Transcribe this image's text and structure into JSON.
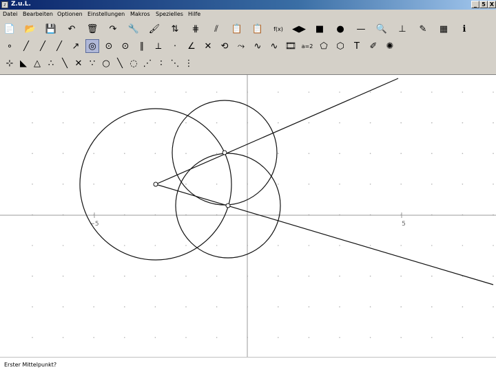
{
  "window": {
    "title": "Z.u.L."
  },
  "window_buttons": {
    "minimize": "_",
    "maximize": "5",
    "close": "X"
  },
  "menu": [
    "Datei",
    "Bearbeiten",
    "Optionen",
    "Einstellungen",
    "Makros",
    "Spezielles",
    "Hilfe"
  ],
  "toolbar": {
    "row1": [
      {
        "name": "new-icon",
        "glyph": "📄"
      },
      {
        "name": "open-icon",
        "glyph": "📂"
      },
      {
        "name": "save-icon",
        "glyph": "💾"
      },
      {
        "name": "undo-icon",
        "glyph": "↶"
      },
      {
        "name": "delete-icon",
        "glyph": "🗑"
      },
      {
        "name": "redo-icon",
        "glyph": "↷"
      },
      {
        "name": "tools-icon",
        "glyph": "🔧"
      },
      {
        "name": "paint-icon",
        "glyph": "🖌"
      },
      {
        "name": "sort-icon",
        "glyph": "⇅"
      },
      {
        "name": "grid-lines-icon",
        "glyph": "⋕"
      },
      {
        "name": "hatch-icon",
        "glyph": "⫽"
      },
      {
        "name": "document-icon",
        "glyph": "📋"
      },
      {
        "name": "clipboard-icon",
        "glyph": "📋"
      },
      {
        "name": "function-icon",
        "glyph": "f(x)"
      },
      {
        "name": "arrows-icon",
        "glyph": "◀▶"
      },
      {
        "name": "black-square-icon",
        "glyph": "■"
      },
      {
        "name": "dot-icon",
        "glyph": "●"
      },
      {
        "name": "line-style-icon",
        "glyph": "—"
      },
      {
        "name": "zoom-icon",
        "glyph": "🔍"
      },
      {
        "name": "axes-icon",
        "glyph": "⊥"
      },
      {
        "name": "magic-icon",
        "glyph": "✎"
      },
      {
        "name": "colors-icon",
        "glyph": "▦"
      },
      {
        "name": "info-icon",
        "glyph": "ℹ"
      }
    ],
    "row2": [
      {
        "name": "point-icon",
        "glyph": "∘"
      },
      {
        "name": "segment-icon",
        "glyph": "╱"
      },
      {
        "name": "line-icon",
        "glyph": "╱"
      },
      {
        "name": "ray-icon",
        "glyph": "╱"
      },
      {
        "name": "vector-icon",
        "glyph": "↗"
      },
      {
        "name": "circle-tool-icon",
        "glyph": "◎",
        "selected": true
      },
      {
        "name": "circle3-icon",
        "glyph": "⊙"
      },
      {
        "name": "circle-fixed-icon",
        "glyph": "⊙"
      },
      {
        "name": "parallel-icon",
        "glyph": "∥"
      },
      {
        "name": "perpendicular-icon",
        "glyph": "⟂"
      },
      {
        "name": "midpoint-icon",
        "glyph": "⋅"
      },
      {
        "name": "angle-bisector-icon",
        "glyph": "∠"
      },
      {
        "name": "intersection-icon",
        "glyph": "✕"
      },
      {
        "name": "reflect-icon",
        "glyph": "⟲"
      },
      {
        "name": "transform-icon",
        "glyph": "⤳"
      },
      {
        "name": "function-plot-icon",
        "glyph": "∿"
      },
      {
        "name": "curve-icon",
        "glyph": "∿"
      },
      {
        "name": "film-icon",
        "glyph": "🎞"
      },
      {
        "name": "equation-icon",
        "glyph": "a=2"
      },
      {
        "name": "polygon-icon",
        "glyph": "⬠"
      },
      {
        "name": "quadrilateral-icon",
        "glyph": "⬡"
      },
      {
        "name": "text-icon",
        "glyph": "T"
      },
      {
        "name": "hide-icon",
        "glyph": "✐"
      },
      {
        "name": "fill-icon",
        "glyph": "✺"
      }
    ],
    "row3": [
      {
        "name": "tool-a-icon",
        "glyph": "⊹"
      },
      {
        "name": "tool-b-icon",
        "glyph": "◣"
      },
      {
        "name": "triangle-icon",
        "glyph": "△"
      },
      {
        "name": "tool-c-icon",
        "glyph": "∴"
      },
      {
        "name": "tool-d-icon",
        "glyph": "╲"
      },
      {
        "name": "tool-e-icon",
        "glyph": "✕"
      },
      {
        "name": "tool-f-icon",
        "glyph": "∵"
      },
      {
        "name": "circle-outline-icon",
        "glyph": "○"
      },
      {
        "name": "tool-g-icon",
        "glyph": "╲"
      },
      {
        "name": "tool-h-icon",
        "glyph": "◌"
      },
      {
        "name": "tool-i-icon",
        "glyph": "⋰"
      },
      {
        "name": "tool-j-icon",
        "glyph": "∶"
      },
      {
        "name": "tool-k-icon",
        "glyph": "⋱"
      },
      {
        "name": "tool-l-icon",
        "glyph": "⋮"
      }
    ]
  },
  "axis_labels": {
    "x_neg": "−5",
    "x_pos": "5"
  },
  "status": {
    "text": "Erster Mittelpunkt?"
  }
}
